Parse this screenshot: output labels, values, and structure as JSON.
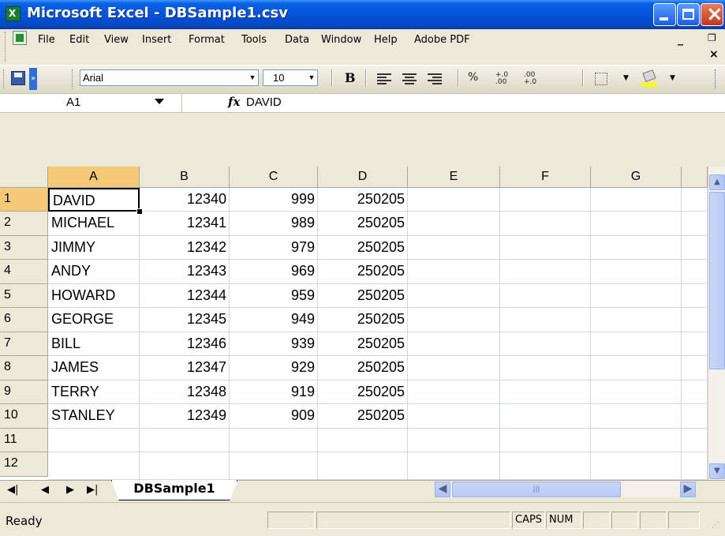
{
  "window": {
    "title": "Microsoft Excel - DBSample1.csv",
    "app_icon": "excel-icon"
  },
  "menu": {
    "items": [
      "File",
      "Edit",
      "View",
      "Insert",
      "Format",
      "Tools",
      "Data",
      "Window",
      "Help",
      "Adobe PDF"
    ]
  },
  "toolbar": {
    "font": "Arial",
    "font_size": "10",
    "bold": "B",
    "percent": "%",
    "inc_decimal": "+.0 .00",
    "dec_decimal": ".00 +.0"
  },
  "formula_bar": {
    "name_box": "A1",
    "fx": "fx",
    "value": "DAVID"
  },
  "sheet": {
    "columns": [
      "A",
      "B",
      "C",
      "D",
      "E",
      "F",
      "G"
    ],
    "rows": [
      "1",
      "2",
      "3",
      "4",
      "5",
      "6",
      "7",
      "8",
      "9",
      "10",
      "11",
      "12"
    ],
    "selected_cell": "A1",
    "data": [
      [
        "DAVID",
        "12340",
        "999",
        "250205"
      ],
      [
        "MICHAEL",
        "12341",
        "989",
        "250205"
      ],
      [
        "JIMMY",
        "12342",
        "979",
        "250205"
      ],
      [
        "ANDY",
        "12343",
        "969",
        "250205"
      ],
      [
        "HOWARD",
        "12344",
        "959",
        "250205"
      ],
      [
        "GEORGE",
        "12345",
        "949",
        "250205"
      ],
      [
        "BILL",
        "12346",
        "939",
        "250205"
      ],
      [
        "JAMES",
        "12347",
        "929",
        "250205"
      ],
      [
        "TERRY",
        "12348",
        "919",
        "250205"
      ],
      [
        "STANLEY",
        "12349",
        "909",
        "250205"
      ]
    ],
    "tab_name": "DBSample1"
  },
  "status": {
    "text": "Ready",
    "caps": "CAPS",
    "num": "NUM"
  },
  "colors": {
    "titlebar": "#0553d9",
    "selected_header": "#f5c978",
    "chrome": "#ece9d8",
    "gridline": "#d0d7e5"
  }
}
